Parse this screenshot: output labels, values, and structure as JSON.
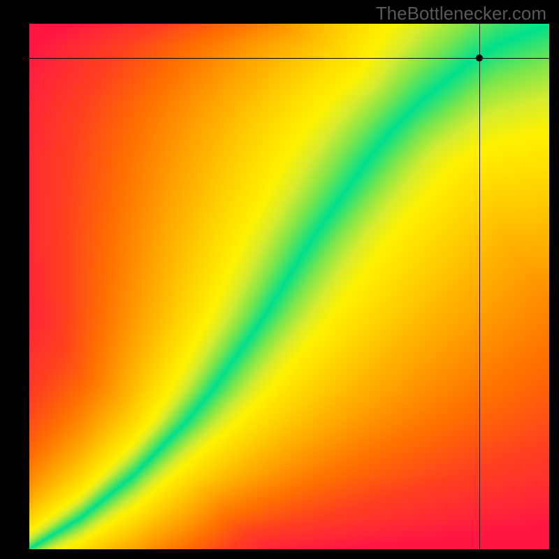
{
  "watermark": "TheBottlenecker.com",
  "chart_data": {
    "type": "heatmap",
    "title": "",
    "xlabel": "",
    "ylabel": "",
    "xlim": [
      0,
      1
    ],
    "ylim": [
      0,
      1
    ],
    "grid": false,
    "crosshair": {
      "x": 0.865,
      "y": 0.935
    },
    "optimal_curve": [
      {
        "x": 0.0,
        "y": 0.0
      },
      {
        "x": 0.05,
        "y": 0.03
      },
      {
        "x": 0.1,
        "y": 0.06
      },
      {
        "x": 0.15,
        "y": 0.1
      },
      {
        "x": 0.2,
        "y": 0.14
      },
      {
        "x": 0.25,
        "y": 0.19
      },
      {
        "x": 0.3,
        "y": 0.24
      },
      {
        "x": 0.35,
        "y": 0.3
      },
      {
        "x": 0.4,
        "y": 0.37
      },
      {
        "x": 0.45,
        "y": 0.44
      },
      {
        "x": 0.5,
        "y": 0.52
      },
      {
        "x": 0.55,
        "y": 0.6
      },
      {
        "x": 0.6,
        "y": 0.67
      },
      {
        "x": 0.65,
        "y": 0.74
      },
      {
        "x": 0.7,
        "y": 0.8
      },
      {
        "x": 0.75,
        "y": 0.85
      },
      {
        "x": 0.8,
        "y": 0.89
      },
      {
        "x": 0.85,
        "y": 0.93
      },
      {
        "x": 0.9,
        "y": 0.96
      },
      {
        "x": 0.95,
        "y": 0.98
      },
      {
        "x": 1.0,
        "y": 1.0
      }
    ],
    "color_stops": [
      {
        "t": 0.0,
        "color": "#00e08c"
      },
      {
        "t": 0.08,
        "color": "#7de64a"
      },
      {
        "t": 0.15,
        "color": "#d4ec2f"
      },
      {
        "t": 0.22,
        "color": "#fff200"
      },
      {
        "t": 0.35,
        "color": "#ffd000"
      },
      {
        "t": 0.5,
        "color": "#ffa200"
      },
      {
        "t": 0.65,
        "color": "#ff7000"
      },
      {
        "t": 0.8,
        "color": "#ff4020"
      },
      {
        "t": 1.0,
        "color": "#ff1744"
      }
    ]
  }
}
